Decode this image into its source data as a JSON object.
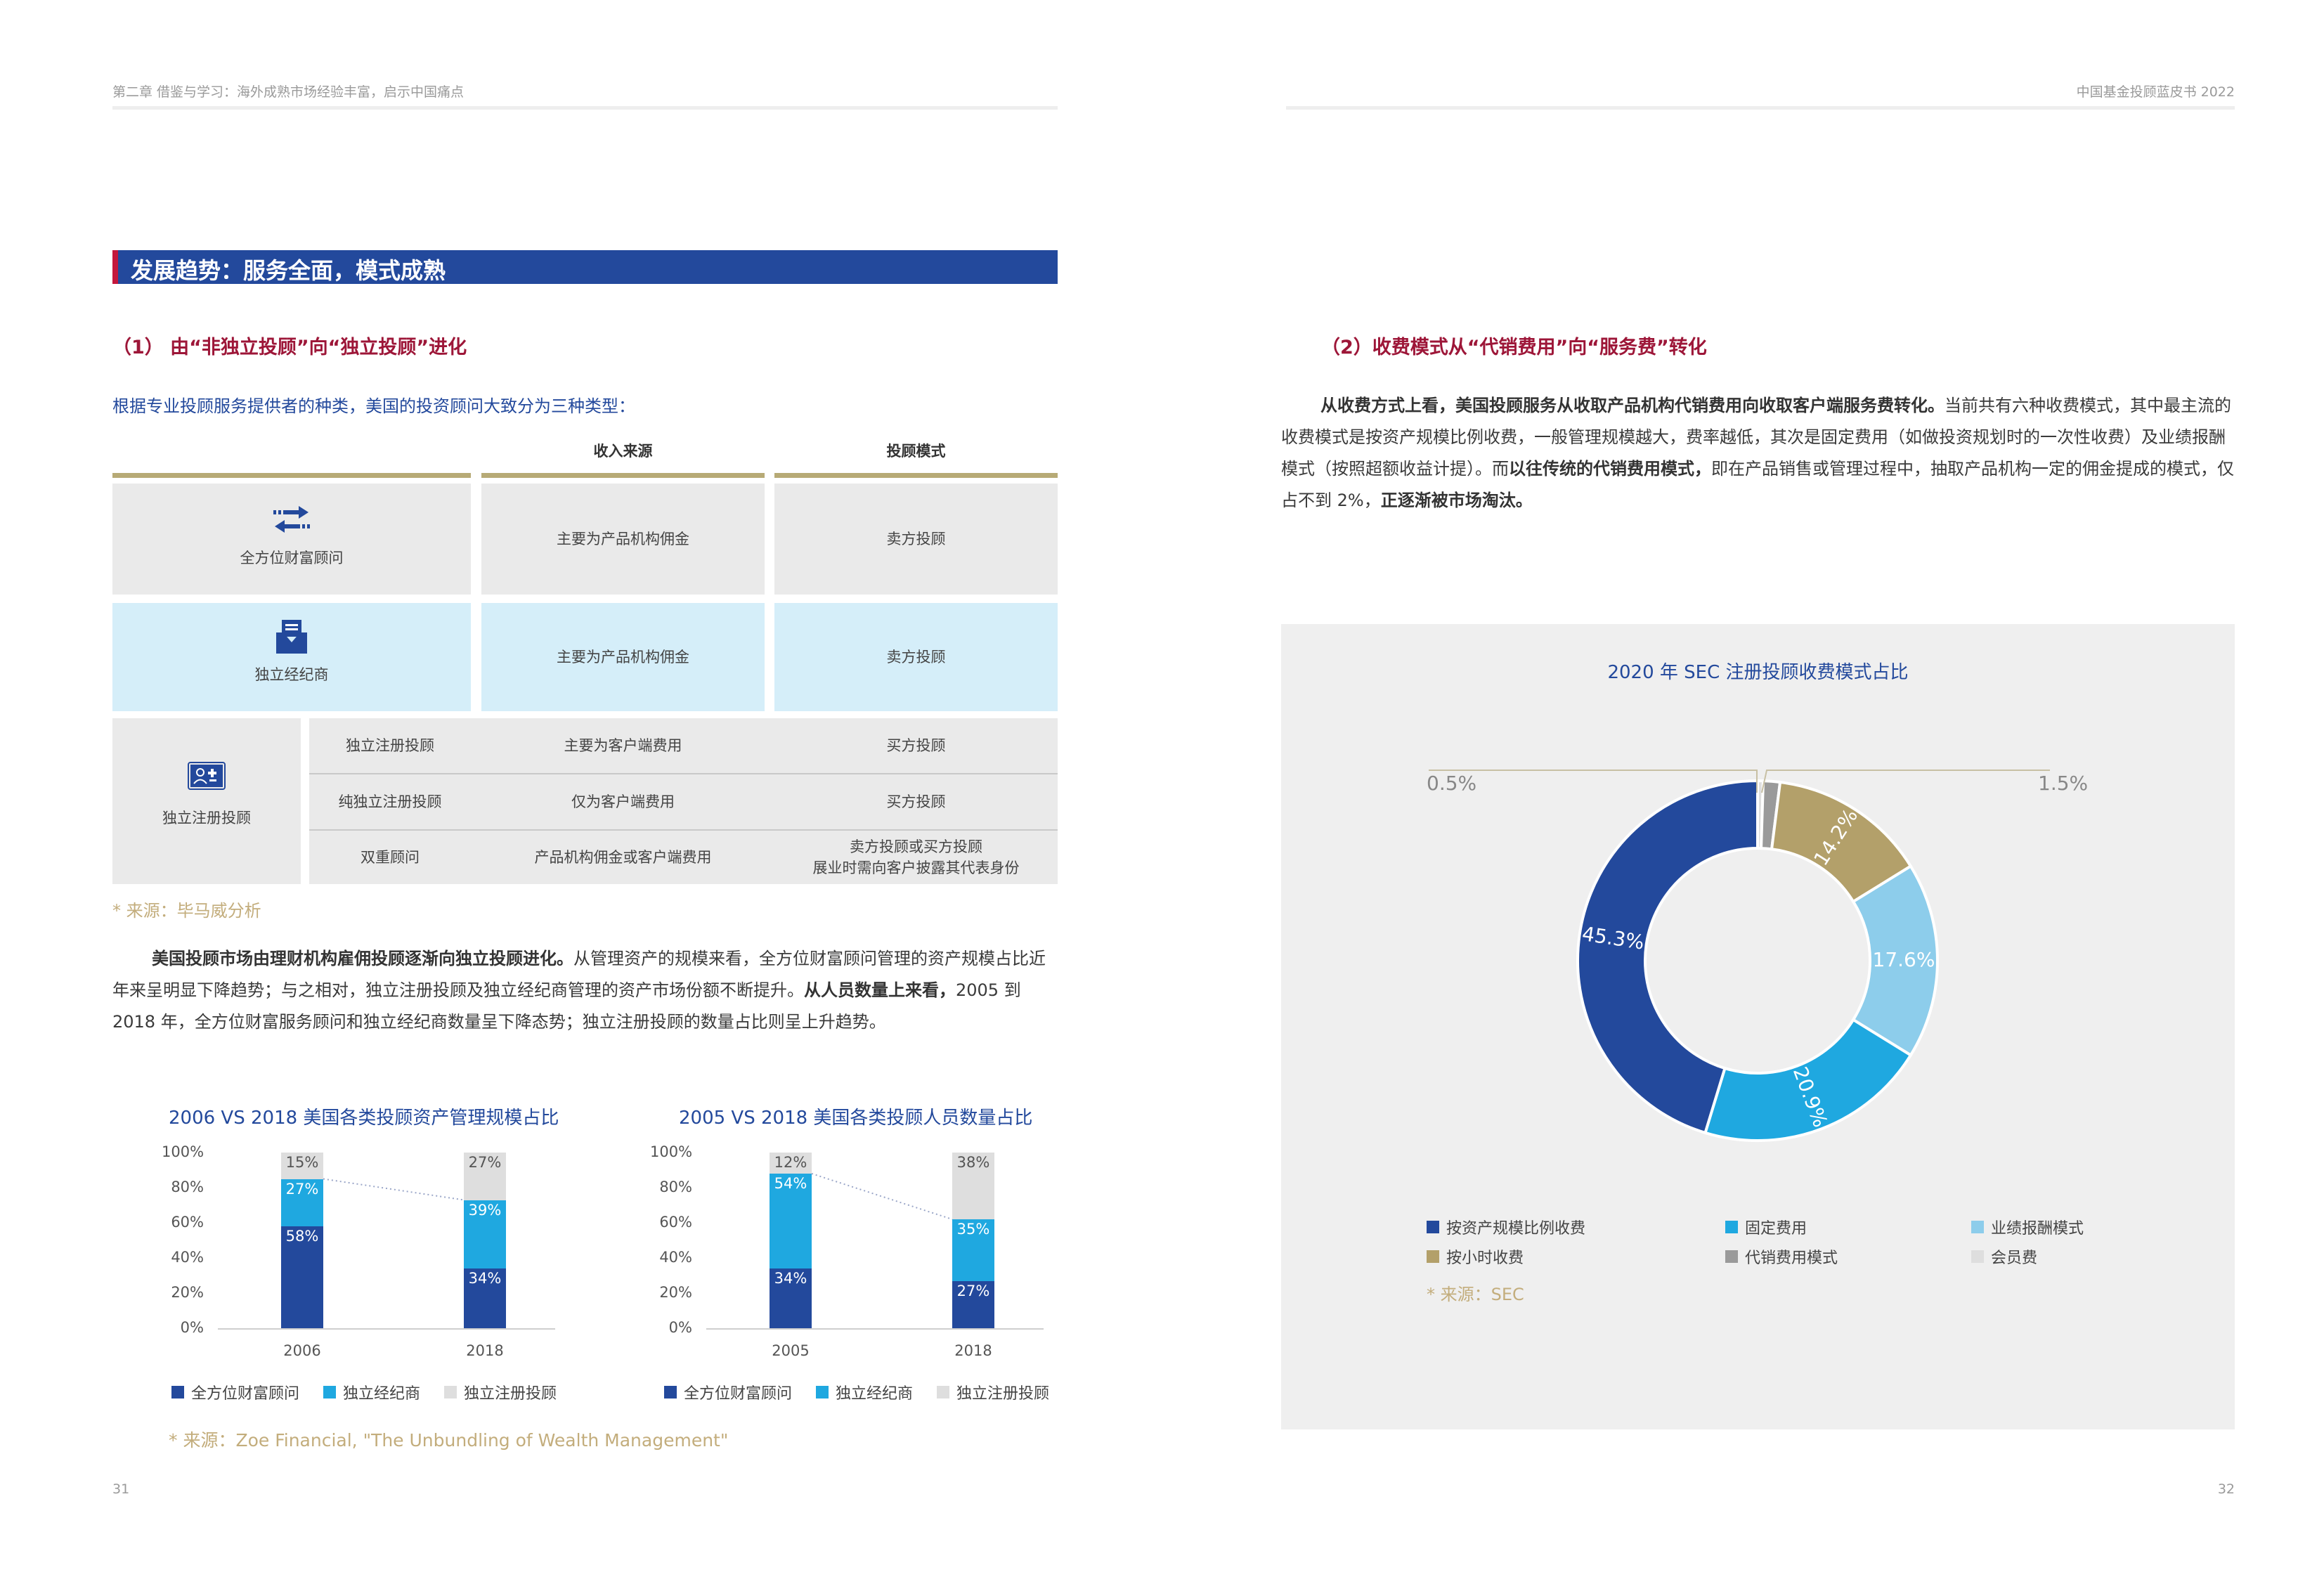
{
  "left_page": {
    "running_header": "第二章 借鉴与学习：海外成熟市场经验丰富，启示中国痛点",
    "page_number": "31",
    "section_title": "发展趋势：服务全面，模式成熟",
    "subheading": "（1）  由“非独立投顾”向“独立投顾”进化",
    "intro": "根据专业投顾服务提供者的种类，美国的投资顾问大致分为三种类型：",
    "table": {
      "headers": [
        "收入来源",
        "投顾模式"
      ],
      "rows": [
        {
          "type": "全方位财富顾问",
          "icon": "transfer-arrows-icon",
          "income": "主要为产品机构佣金",
          "mode": "卖方投顾"
        },
        {
          "type": "独立经纪商",
          "icon": "inbox-document-icon",
          "income": "主要为产品机构佣金",
          "mode": "卖方投顾"
        },
        {
          "type": "独立注册投顾",
          "icon": "people-id-icon",
          "sub": [
            {
              "name": "独立注册投顾",
              "income": "主要为客户端费用",
              "mode": "买方投顾"
            },
            {
              "name": "纯独立注册投顾",
              "income": "仅为客户端费用",
              "mode": "买方投顾"
            },
            {
              "name": "双重顾问",
              "income": "产品机构佣金或客户端费用",
              "mode": "卖方投顾或买方投顾",
              "mode2": "展业时需向客户披露其代表身份"
            }
          ]
        }
      ],
      "source": "* 来源：毕马威分析"
    },
    "paragraph": {
      "bold1": "美国投顾市场由理财机构雇佣投顾逐渐向独立投顾进化。",
      "text1": "从管理资产的规模来看，全方位财富顾问管理的资产规模占比近年来呈明显下降趋势；与之相对，独立注册投顾及独立经纪商管理的资产市场份额不断提升。",
      "bold2": "从人员数量上来看，",
      "text2": "2005 到 2018 年，全方位财富服务顾问和独立经纪商数量呈下降态势；独立注册投顾的数量占比则呈上升趋势。"
    },
    "chart_source": "* 来源：Zoe Financial, \"The Unbundling of Wealth Management\""
  },
  "right_page": {
    "running_header": "中国基金投顾蓝皮书 2022",
    "page_number": "32",
    "subheading": "（2）收费模式从“代销费用”向“服务费”转化",
    "paragraph": {
      "bold1": "从收费方式上看，美国投顾服务从收取产品机构代销费用向收取客户端服务费转化。",
      "text1": "当前共有六种收费模式，其中最主流的收费模式是按资产规模比例收费，一般管理规模越大，费率越低，其次是固定费用（如做投资规划时的一次性收费）及业绩报酬模式（按照超额收益计提）。而",
      "bold2": "以往传统的代销费用模式，",
      "text2": "即在产品销售或管理过程中，抽取产品机构一定的佣金提成的模式，仅占不到 2%，",
      "bold3": "正逐渐被市场淘汰。"
    },
    "pie_source": "* 来源：SEC"
  },
  "chart_data": [
    {
      "type": "bar",
      "stacked": true,
      "title": "2006 VS 2018 美国各类投顾资产管理规模占比",
      "categories": [
        "2006",
        "2018"
      ],
      "series": [
        {
          "name": "全方位财富顾问",
          "values": [
            58,
            34
          ],
          "labels": [
            "58%",
            "34%"
          ],
          "color": "#23499c"
        },
        {
          "name": "独立经纪商",
          "values": [
            27,
            39
          ],
          "labels": [
            "27%",
            "39%"
          ],
          "color": "#1fa8e0"
        },
        {
          "name": "独立注册投顾",
          "values": [
            15,
            27
          ],
          "labels": [
            "15%",
            "27%"
          ],
          "color": "#dedede"
        }
      ],
      "ylim": [
        0,
        100
      ],
      "yticks": [
        "0%",
        "20%",
        "40%",
        "60%",
        "80%",
        "100%"
      ],
      "legend": "bottom"
    },
    {
      "type": "bar",
      "stacked": true,
      "title": "2005 VS 2018 美国各类投顾人员数量占比",
      "categories": [
        "2005",
        "2018"
      ],
      "series": [
        {
          "name": "全方位财富顾问",
          "values": [
            34,
            27
          ],
          "labels": [
            "34%",
            "27%"
          ],
          "color": "#23499c"
        },
        {
          "name": "独立经纪商",
          "values": [
            54,
            35
          ],
          "labels": [
            "54%",
            "35%"
          ],
          "color": "#1fa8e0"
        },
        {
          "name": "独立注册投顾",
          "values": [
            12,
            38
          ],
          "labels": [
            "12%",
            "38%"
          ],
          "color": "#dedede"
        }
      ],
      "ylim": [
        0,
        100
      ],
      "yticks": [
        "0%",
        "20%",
        "40%",
        "60%",
        "80%",
        "100%"
      ],
      "legend": "bottom"
    },
    {
      "type": "pie",
      "donut": true,
      "title": "2020 年 SEC 注册投顾收费模式占比",
      "slices": [
        {
          "name": "会员费",
          "value": 0.5,
          "label": "0.5%",
          "color": "#dedede"
        },
        {
          "name": "代销费用模式",
          "value": 1.5,
          "label": "1.5%",
          "color": "#9a9a9a"
        },
        {
          "name": "按小时收费",
          "value": 14.2,
          "label": "14.2%",
          "color": "#b3a06a"
        },
        {
          "name": "业绩报酬模式",
          "value": 17.6,
          "label": "17.6%",
          "color": "#8dcdeb"
        },
        {
          "name": "固定费用",
          "value": 20.9,
          "label": "20.9%",
          "color": "#1fa8e0"
        },
        {
          "name": "按资产规模比例收费",
          "value": 45.3,
          "label": "45.3%",
          "color": "#23499c"
        }
      ],
      "legend": [
        {
          "name": "按资产规模比例收费",
          "color": "#23499c"
        },
        {
          "name": "固定费用",
          "color": "#1fa8e0"
        },
        {
          "name": "业绩报酬模式",
          "color": "#8dcdeb"
        },
        {
          "name": "按小时收费",
          "color": "#b3a06a"
        },
        {
          "name": "代销费用模式",
          "color": "#9a9a9a"
        },
        {
          "name": "会员费",
          "color": "#dedede"
        }
      ],
      "legend_position": "bottom"
    }
  ]
}
